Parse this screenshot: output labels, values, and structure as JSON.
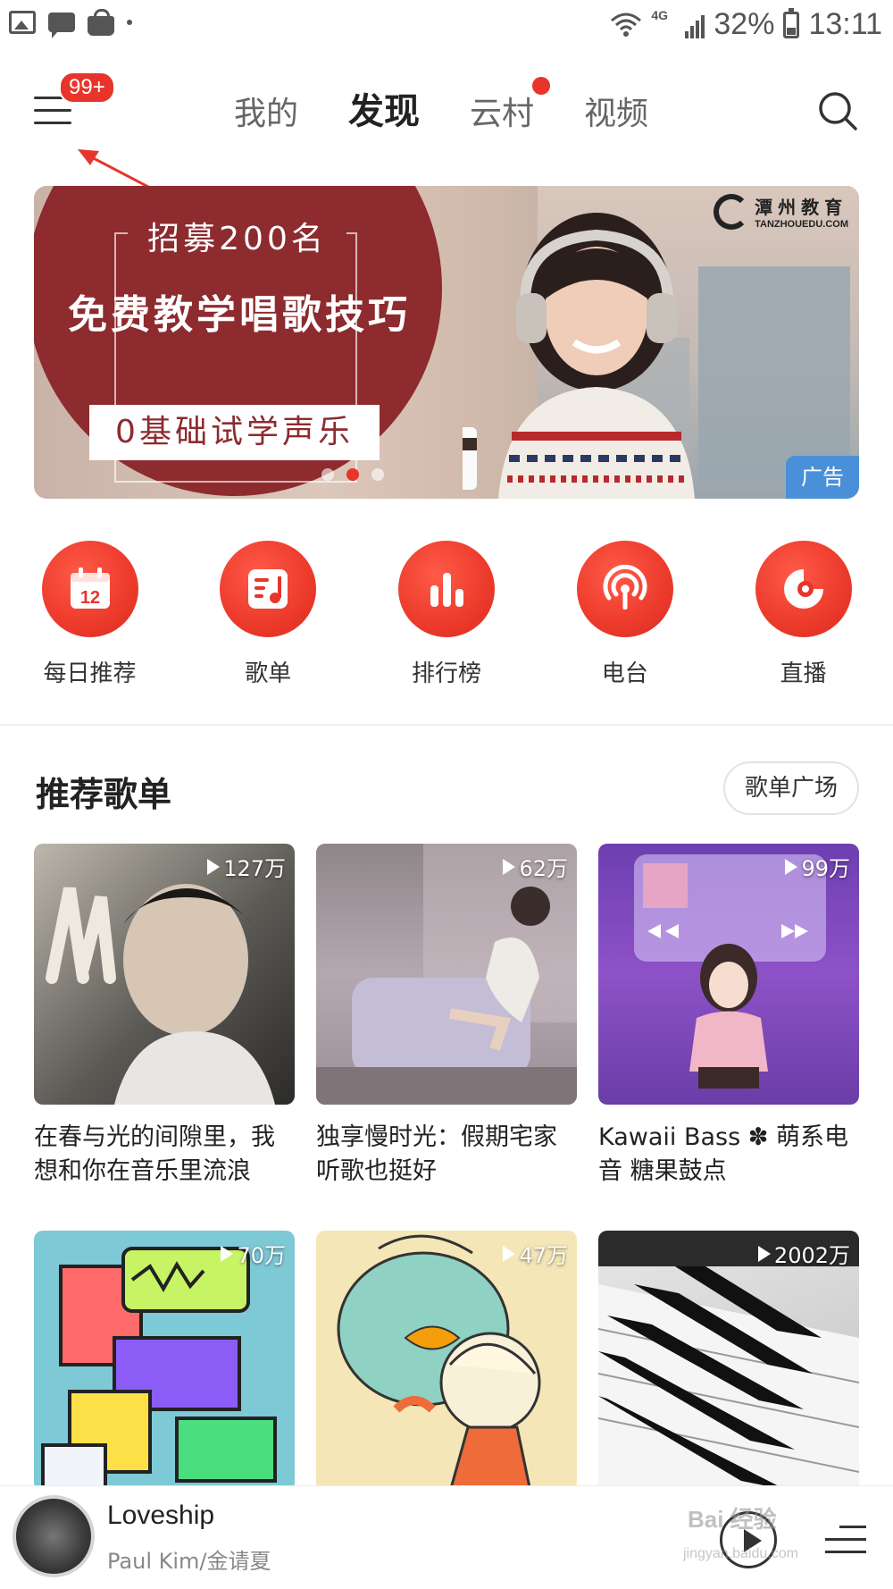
{
  "status_bar": {
    "battery": "32%",
    "time": "13:11",
    "network": "4G"
  },
  "nav": {
    "badge": "99+",
    "tabs": [
      {
        "label": "我的"
      },
      {
        "label": "发现"
      },
      {
        "label": "云村"
      },
      {
        "label": "视频"
      }
    ]
  },
  "banner": {
    "headline": "招募200名",
    "main": "免费教学唱歌技巧",
    "sub": "0基础试学声乐",
    "brand": "潭州教育",
    "brand_url": "TANZHOUEDU.COM",
    "ad_label": "广告",
    "accent": "#8d2b2f"
  },
  "quick_links": [
    {
      "label": "每日推荐",
      "icon": "calendar-icon",
      "day": "12"
    },
    {
      "label": "歌单",
      "icon": "playlist-icon"
    },
    {
      "label": "排行榜",
      "icon": "chart-icon"
    },
    {
      "label": "电台",
      "icon": "radio-icon"
    },
    {
      "label": "直播",
      "icon": "live-icon"
    }
  ],
  "section": {
    "title": "推荐歌单",
    "more_button": "歌单广场"
  },
  "playlists": [
    {
      "plays": "127万",
      "title": "在春与光的间隙里，我想和你在音乐里流浪"
    },
    {
      "plays": "62万",
      "title": "独享慢时光：假期宅家听歌也挺好"
    },
    {
      "plays": "99万",
      "title": "Kawaii Bass ✽ 萌系电音 糖果鼓点"
    },
    {
      "plays": "70万",
      "title": ""
    },
    {
      "plays": "47万",
      "title": ""
    },
    {
      "plays": "2002万",
      "title": ""
    }
  ],
  "player": {
    "title": "Loveship",
    "artist": "Paul Kim/金请夏"
  },
  "watermark": {
    "line1": "Bai 经验",
    "line2": "jingyan.baidu.com"
  },
  "colors": {
    "brand_red": "#e7352c",
    "ad_blue": "#4a90d9"
  }
}
